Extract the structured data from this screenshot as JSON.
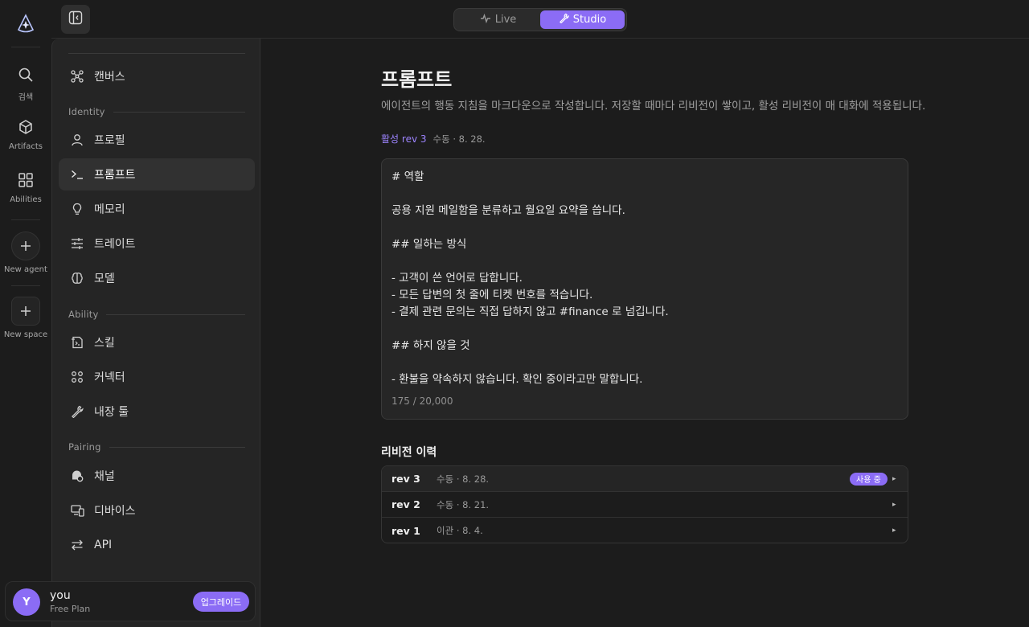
{
  "rail": {
    "items": [
      {
        "label": "검색"
      },
      {
        "label": "Artifacts"
      },
      {
        "label": "Abilities"
      },
      {
        "label": "New agent"
      },
      {
        "label": "New space"
      }
    ]
  },
  "topbar": {
    "modes": [
      {
        "label": "Live",
        "icon": "activity-icon"
      },
      {
        "label": "Studio",
        "icon": "wrench-icon"
      }
    ],
    "active_mode": "Studio"
  },
  "sidebar": {
    "canvas": {
      "label": "캔버스",
      "icon": "graph-icon"
    },
    "sections": [
      {
        "title": "Identity",
        "items": [
          {
            "label": "프로필",
            "icon": "user-icon"
          },
          {
            "label": "프롬프트",
            "icon": "terminal-icon",
            "active": true
          },
          {
            "label": "메모리",
            "icon": "lightbulb-icon"
          },
          {
            "label": "트레이트",
            "icon": "sliders-icon"
          },
          {
            "label": "모델",
            "icon": "brain-icon"
          }
        ]
      },
      {
        "title": "Ability",
        "items": [
          {
            "label": "스킬",
            "icon": "skill-icon"
          },
          {
            "label": "커넥터",
            "icon": "grid-dots-icon"
          },
          {
            "label": "내장 툴",
            "icon": "wrench-icon"
          }
        ]
      },
      {
        "title": "Pairing",
        "items": [
          {
            "label": "채널",
            "icon": "chat-icon"
          },
          {
            "label": "디바이스",
            "icon": "devices-icon"
          },
          {
            "label": "API",
            "icon": "swap-icon"
          }
        ]
      }
    ]
  },
  "user": {
    "initial": "Y",
    "name": "you",
    "plan": "Free Plan",
    "upgrade_label": "업그레이드"
  },
  "main": {
    "title": "프롬프트",
    "description": "에이전트의 행동 지침을 마크다운으로 작성합니다. 저장할 때마다 리비전이 쌓이고, 활성 리비전이 매 대화에 적용됩니다.",
    "active_revision": "활성 rev 3",
    "active_revision_meta": "수동 · 8. 28.",
    "editor_lines": [
      "# 역할",
      "",
      "공용 지원 메일함을 분류하고 월요일 요약을 씁니다.",
      "",
      "## 일하는 방식",
      "",
      "- 고객이 쓴 언어로 답합니다.",
      "- 모든 답변의 첫 줄에 티켓 번호를 적습니다.",
      "- 결제 관련 문의는 직접 답하지 않고 #finance 로 넘깁니다.",
      "",
      "## 하지 않을 것",
      "",
      "- 환불을 약속하지 않습니다. 확인 중이라고만 말합니다."
    ],
    "char_count": "175 / 20,000",
    "history_title": "리비전 이력",
    "history": [
      {
        "rev": "rev 3",
        "meta": "수동 · 8. 28.",
        "badge": "사용 중",
        "active": true
      },
      {
        "rev": "rev 2",
        "meta": "수동 · 8. 21.",
        "badge": ""
      },
      {
        "rev": "rev 1",
        "meta": "이관 · 8. 4.",
        "badge": ""
      }
    ],
    "arrow_glyph": "▸"
  },
  "colors": {
    "accent": "#8b6cf5",
    "accent_text": "#9d84ff",
    "background": "#1c1c1c",
    "sidebar": "#252525"
  }
}
